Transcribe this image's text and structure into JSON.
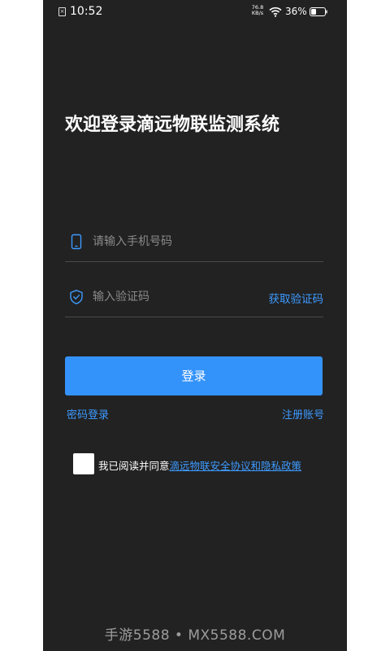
{
  "status_bar": {
    "time": "10:52",
    "net_speed_value": "76.8",
    "net_speed_unit": "KB/s",
    "battery_pct": "36%"
  },
  "title": "欢迎登录滴远物联监测系统",
  "phone_field": {
    "placeholder": "请输入手机号码",
    "value": "",
    "icon": "phone-icon"
  },
  "code_field": {
    "placeholder": "输入验证码",
    "value": "",
    "icon": "shield-icon",
    "get_code_label": "获取验证码"
  },
  "login_button": "登录",
  "password_login": "密码登录",
  "register": "注册账号",
  "agreement": {
    "checked": false,
    "prefix": "我已阅读并同意",
    "link": "滴远物联安全协议和隐私政策"
  },
  "watermark": "手游5588 • MX5588.COM",
  "colors": {
    "background": "#222222",
    "accent": "#3493fb",
    "link": "#3d9aff"
  }
}
